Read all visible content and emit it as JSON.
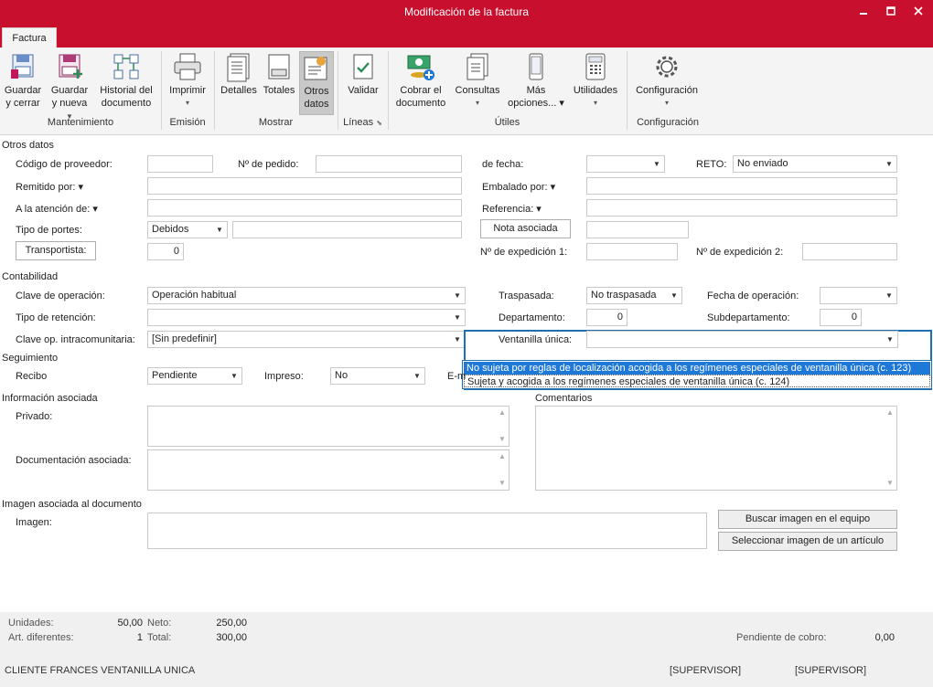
{
  "window": {
    "title": "Modificación de la factura"
  },
  "tabs": {
    "active": "Factura"
  },
  "ribbon": {
    "buttons": {
      "guardar_cerrar": [
        "Guardar",
        "y cerrar"
      ],
      "guardar_nueva": [
        "Guardar",
        "y nueva"
      ],
      "historial": [
        "Historial del",
        "documento"
      ],
      "imprimir": [
        "Imprimir",
        "▾"
      ],
      "detalles": [
        "Detalles",
        ""
      ],
      "totales": [
        "Totales",
        ""
      ],
      "otros": [
        "Otros",
        "datos"
      ],
      "validar": [
        "Validar",
        ""
      ],
      "cobrar": [
        "Cobrar el",
        "documento"
      ],
      "consultas": [
        "Consultas",
        "▾"
      ],
      "mas": [
        "Más",
        "opciones... ▾"
      ],
      "utilidades": [
        "Utilidades",
        "▾"
      ],
      "configuracion": [
        "Configuración",
        "▾"
      ]
    },
    "groups": {
      "mantenimiento": "Mantenimiento",
      "emision": "Emisión",
      "mostrar": "Mostrar",
      "lineas": "Líneas",
      "utiles": "Útiles",
      "configuracion": "Configuración"
    }
  },
  "otros_datos": {
    "section": "Otros datos",
    "codigo_proveedor": {
      "label": "Código de proveedor:",
      "value": ""
    },
    "n_pedido": {
      "label": "Nº de pedido:",
      "value": ""
    },
    "de_fecha": {
      "label": "de fecha:",
      "value": ""
    },
    "reto": {
      "label": "RETO:",
      "value": "No enviado"
    },
    "remitido_por": {
      "label": "Remitido por: ▾",
      "value": ""
    },
    "embalado_por": {
      "label": "Embalado por: ▾",
      "value": ""
    },
    "atencion": {
      "label": "A la atención de: ▾",
      "value": ""
    },
    "referencia": {
      "label": "Referencia: ▾",
      "value": ""
    },
    "tipo_portes": {
      "label": "Tipo de portes:",
      "value": "Debidos",
      "extra": ""
    },
    "nota_asociada": {
      "label": "Nota asociada",
      "value": ""
    },
    "transportista": {
      "label": "Transportista:",
      "value": "0"
    },
    "expedicion1": {
      "label": "Nº de expedición 1:",
      "value": ""
    },
    "expedicion2": {
      "label": "Nº de expedición 2:",
      "value": ""
    }
  },
  "contabilidad": {
    "section": "Contabilidad",
    "clave_operacion": {
      "label": "Clave de operación:",
      "value": "Operación habitual"
    },
    "traspasada": {
      "label": "Traspasada:",
      "value": "No traspasada"
    },
    "fecha_operacion": {
      "label": "Fecha de operación:",
      "value": ""
    },
    "tipo_retencion": {
      "label": "Tipo de retención:",
      "value": ""
    },
    "departamento": {
      "label": "Departamento:",
      "value": "0"
    },
    "subdepartamento": {
      "label": "Subdepartamento:",
      "value": "0"
    },
    "clave_intracom": {
      "label": "Clave op. intracomunitaria:",
      "value": "[Sin predefinir]"
    },
    "ventanilla_unica": {
      "label": "Ventanilla única:",
      "value": "",
      "options": [
        "No sujeta por reglas de localización acogida a los regímenes especiales de ventanilla única (c. 123)",
        "Sujeta y acogida a los regímenes especiales de ventanilla única (c. 124)"
      ]
    }
  },
  "seguimiento": {
    "section": "Seguimiento",
    "recibo": {
      "label": "Recibo",
      "value": "Pendiente"
    },
    "impreso": {
      "label": "Impreso:",
      "value": "No"
    },
    "email_label": "E-m"
  },
  "info_asociada": {
    "section": "Información asociada",
    "privado": "Privado:",
    "documentacion": "Documentación asociada:",
    "comentarios": "Comentarios"
  },
  "imagen": {
    "section": "Imagen asociada al documento",
    "label": "Imagen:",
    "buscar": "Buscar imagen en el equipo",
    "seleccionar": "Seleccionar imagen de un artículo"
  },
  "footer": {
    "unidades_label": "Unidades:",
    "unidades": "50,00",
    "neto_label": "Neto:",
    "neto": "250,00",
    "art_label": "Art. diferentes:",
    "art": "1",
    "total_label": "Total:",
    "total": "300,00",
    "pendiente_label": "Pendiente de cobro:",
    "pendiente": "0,00",
    "cliente": "CLIENTE FRANCES VENTANILLA UNICA",
    "user1": "[SUPERVISOR]",
    "user2": "[SUPERVISOR]"
  },
  "colors": {
    "brand": "#c8102e",
    "selection": "#1e78d7",
    "focus": "#1f6fb5"
  }
}
